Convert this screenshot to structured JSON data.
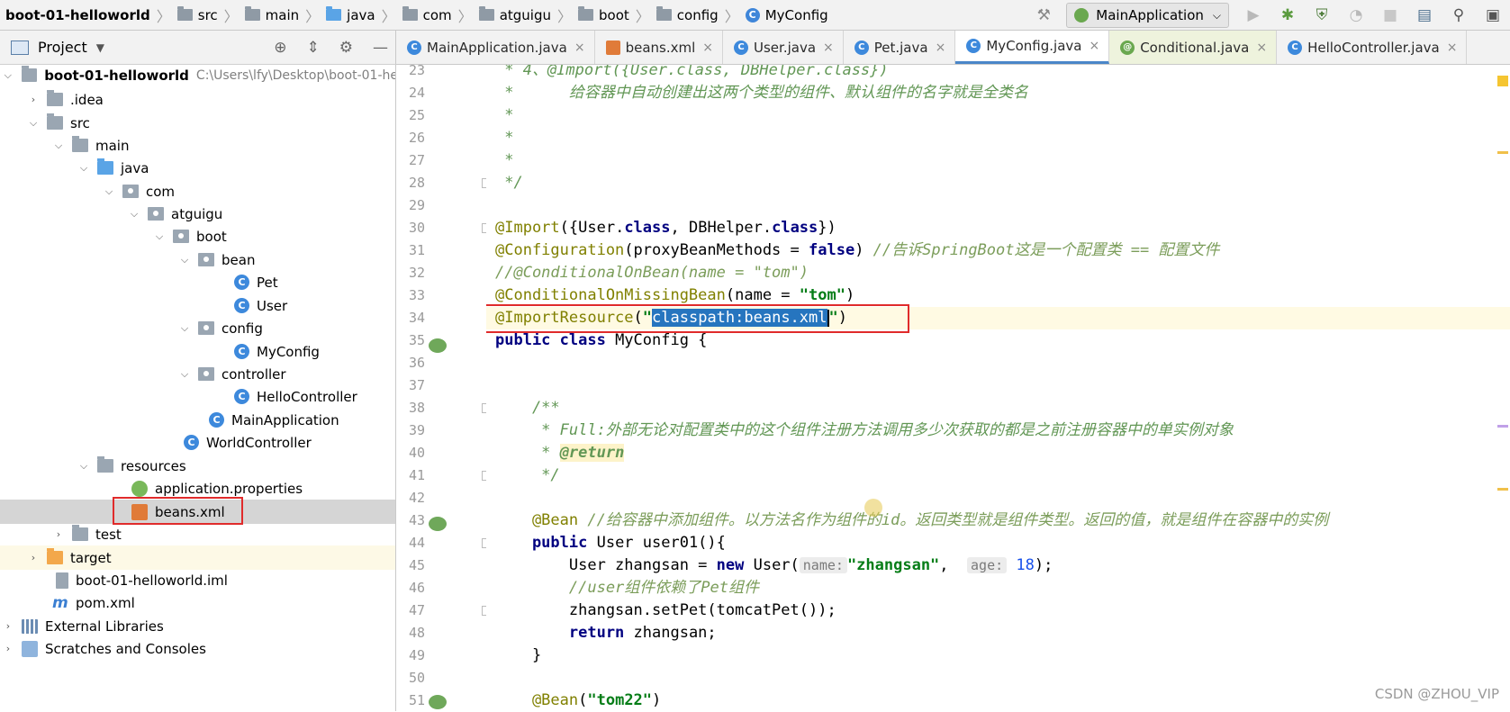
{
  "breadcrumb": {
    "items": [
      "boot-01-helloworld",
      "src",
      "main",
      "java",
      "com",
      "atguigu",
      "boot",
      "config",
      "MyConfig"
    ]
  },
  "toolbar": {
    "run_config": "MainApplication"
  },
  "project_panel": {
    "title": "Project"
  },
  "tree": {
    "root_label": "boot-01-helloworld",
    "root_path": "C:\\Users\\lfy\\Desktop\\boot-01-he",
    "idea": ".idea",
    "src": "src",
    "main": "main",
    "java": "java",
    "com": "com",
    "atguigu": "atguigu",
    "boot": "boot",
    "bean": "bean",
    "pet": "Pet",
    "user": "User",
    "config": "config",
    "myconfig": "MyConfig",
    "controller": "controller",
    "hellocontroller": "HelloController",
    "mainapp": "MainApplication",
    "worldcontroller": "WorldController",
    "resources": "resources",
    "app_props": "application.properties",
    "beans_xml": "beans.xml",
    "test": "test",
    "target": "target",
    "iml": "boot-01-helloworld.iml",
    "pom": "pom.xml",
    "ext_libs": "External Libraries",
    "scratches": "Scratches and Consoles"
  },
  "tabs": [
    "MainApplication.java",
    "beans.xml",
    "User.java",
    "Pet.java",
    "MyConfig.java",
    "Conditional.java",
    "HelloController.java"
  ],
  "editor": {
    "line_numbers": [
      "23",
      "24",
      "25",
      "26",
      "27",
      "28",
      "29",
      "30",
      "31",
      "32",
      "33",
      "34",
      "35",
      "36",
      "37",
      "38",
      "39",
      "40",
      "41",
      "42",
      "43",
      "44",
      "45",
      "46",
      "47",
      "48",
      "49",
      "50",
      "51"
    ],
    "l23": " * 4、@Import({User.class, DBHelper.class})",
    "l24": " *      给容器中自动创建出这两个类型的组件、默认组件的名字就是全类名",
    "l25": " *",
    "l26": " *",
    "l27": " *",
    "l28": " */",
    "l30_a": "@Import",
    "l30_b": "({User.",
    "l30_c": "class",
    "l30_d": ", DBHelper.",
    "l30_e": "class",
    "l30_f": "})",
    "l31_a": "@Configuration",
    "l31_b": "(proxyBeanMethods = ",
    "l31_c": "false",
    "l31_d": ") ",
    "l31_e": "//告诉SpringBoot这是一个配置类 == 配置文件",
    "l32": "//@ConditionalOnBean(name = \"tom\")",
    "l33_a": "@ConditionalOnMissingBean",
    "l33_b": "(name = ",
    "l33_c": "\"tom\"",
    "l33_d": ")",
    "l34_a": "@ImportResource",
    "l34_b": "(",
    "l34_c": "\"",
    "l34_sel": "classpath:beans.xml",
    "l34_d": "\"",
    "l34_e": ")",
    "l35_a": "public class",
    "l35_b": " MyConfig {",
    "l38": "    /**",
    "l39": "     * Full:外部无论对配置类中的这个组件注册方法调用多少次获取的都是之前注册容器中的单实例对象",
    "l40_a": "     * ",
    "l40_b": "@return",
    "l41": "     */",
    "l43_a": "    @Bean",
    "l43_b": " //给容器中添加组件。以方法名作为组件的id。返回类型就是组件类型。返回的值，就是组件在容器中的实例",
    "l44_a": "    public",
    "l44_b": " User user01(){",
    "l45_a": "        User zhangsan = ",
    "l45_b": "new",
    "l45_c": " User(",
    "l45_h1": "name:",
    "l45_s": "\"zhangsan\"",
    "l45_d": ",  ",
    "l45_h2": "age:",
    "l45_n": "18",
    "l45_e": ");",
    "l46": "        //user组件依赖了Pet组件",
    "l47": "        zhangsan.setPet(tomcatPet());",
    "l48_a": "        return",
    "l48_b": " zhangsan;",
    "l49": "    }",
    "l51_a": "    @Bean",
    "l51_b": "(",
    "l51_s": "\"tom22\"",
    "l51_c": ")"
  },
  "watermark": "CSDN @ZHOU_VIP"
}
